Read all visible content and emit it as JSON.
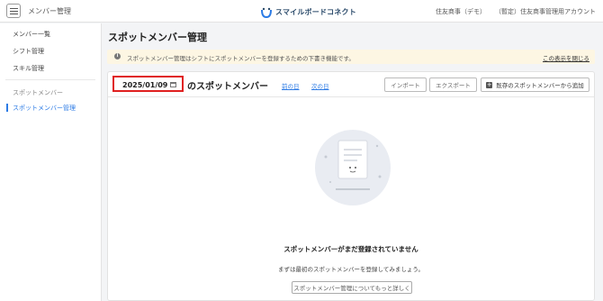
{
  "header": {
    "app_title": "メンバー管理",
    "logo_text": "スマイルボードコネクト",
    "company": "住友商事（デモ）",
    "account": "（暫定）住友商事管理用アカウント"
  },
  "sidebar": {
    "items": [
      {
        "label": "メンバー一覧"
      },
      {
        "label": "シフト管理"
      },
      {
        "label": "スキル管理"
      }
    ],
    "group_label": "スポットメンバー",
    "active_item": {
      "label": "スポットメンバー管理"
    }
  },
  "main": {
    "page_title": "スポットメンバー管理",
    "notice": {
      "text": "スポットメンバー管理はシフトにスポットメンバーを登録するための下書き機能です。",
      "close_link": "この表示を閉じる"
    },
    "toolbar": {
      "date": "2025/01/09",
      "date_suffix": "のスポットメンバー",
      "prev_label": "前の日",
      "next_label": "次の日",
      "import_label": "インポート",
      "export_label": "エクスポート",
      "add_label": "既存のスポットメンバーから追加"
    },
    "empty_state": {
      "title": "スポットメンバーがまだ登録されていません",
      "subtitle": "まずは最初のスポットメンバーを登録してみましょう。",
      "learn_more": "スポットメンバー管理についてもっと詳しく"
    }
  },
  "colors": {
    "accent": "#2c7be5",
    "highlight_border": "#e02020",
    "notice_bg": "#fdf6e3"
  }
}
